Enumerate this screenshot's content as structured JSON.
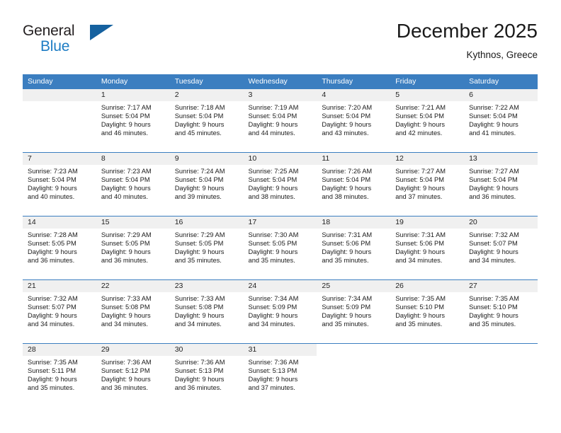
{
  "brand": {
    "name_top": "General",
    "name_bottom": "Blue",
    "logo_icon": "triangle-logo-icon"
  },
  "header": {
    "title": "December 2025",
    "subtitle": "Kythnos, Greece"
  },
  "calendar": {
    "weekday_headers": [
      "Sunday",
      "Monday",
      "Tuesday",
      "Wednesday",
      "Thursday",
      "Friday",
      "Saturday"
    ],
    "colors": {
      "header_blue": "#3b7ec0",
      "brand_blue": "#1d7cc4",
      "logo_blue": "#15619f",
      "daynum_band": "#f0f0f0"
    },
    "weeks": [
      [
        {
          "day": "",
          "detail": ""
        },
        {
          "day": "1",
          "detail": "Sunrise: 7:17 AM\nSunset: 5:04 PM\nDaylight: 9 hours\nand 46 minutes."
        },
        {
          "day": "2",
          "detail": "Sunrise: 7:18 AM\nSunset: 5:04 PM\nDaylight: 9 hours\nand 45 minutes."
        },
        {
          "day": "3",
          "detail": "Sunrise: 7:19 AM\nSunset: 5:04 PM\nDaylight: 9 hours\nand 44 minutes."
        },
        {
          "day": "4",
          "detail": "Sunrise: 7:20 AM\nSunset: 5:04 PM\nDaylight: 9 hours\nand 43 minutes."
        },
        {
          "day": "5",
          "detail": "Sunrise: 7:21 AM\nSunset: 5:04 PM\nDaylight: 9 hours\nand 42 minutes."
        },
        {
          "day": "6",
          "detail": "Sunrise: 7:22 AM\nSunset: 5:04 PM\nDaylight: 9 hours\nand 41 minutes."
        }
      ],
      [
        {
          "day": "7",
          "detail": "Sunrise: 7:23 AM\nSunset: 5:04 PM\nDaylight: 9 hours\nand 40 minutes."
        },
        {
          "day": "8",
          "detail": "Sunrise: 7:23 AM\nSunset: 5:04 PM\nDaylight: 9 hours\nand 40 minutes."
        },
        {
          "day": "9",
          "detail": "Sunrise: 7:24 AM\nSunset: 5:04 PM\nDaylight: 9 hours\nand 39 minutes."
        },
        {
          "day": "10",
          "detail": "Sunrise: 7:25 AM\nSunset: 5:04 PM\nDaylight: 9 hours\nand 38 minutes."
        },
        {
          "day": "11",
          "detail": "Sunrise: 7:26 AM\nSunset: 5:04 PM\nDaylight: 9 hours\nand 38 minutes."
        },
        {
          "day": "12",
          "detail": "Sunrise: 7:27 AM\nSunset: 5:04 PM\nDaylight: 9 hours\nand 37 minutes."
        },
        {
          "day": "13",
          "detail": "Sunrise: 7:27 AM\nSunset: 5:04 PM\nDaylight: 9 hours\nand 36 minutes."
        }
      ],
      [
        {
          "day": "14",
          "detail": "Sunrise: 7:28 AM\nSunset: 5:05 PM\nDaylight: 9 hours\nand 36 minutes."
        },
        {
          "day": "15",
          "detail": "Sunrise: 7:29 AM\nSunset: 5:05 PM\nDaylight: 9 hours\nand 36 minutes."
        },
        {
          "day": "16",
          "detail": "Sunrise: 7:29 AM\nSunset: 5:05 PM\nDaylight: 9 hours\nand 35 minutes."
        },
        {
          "day": "17",
          "detail": "Sunrise: 7:30 AM\nSunset: 5:05 PM\nDaylight: 9 hours\nand 35 minutes."
        },
        {
          "day": "18",
          "detail": "Sunrise: 7:31 AM\nSunset: 5:06 PM\nDaylight: 9 hours\nand 35 minutes."
        },
        {
          "day": "19",
          "detail": "Sunrise: 7:31 AM\nSunset: 5:06 PM\nDaylight: 9 hours\nand 34 minutes."
        },
        {
          "day": "20",
          "detail": "Sunrise: 7:32 AM\nSunset: 5:07 PM\nDaylight: 9 hours\nand 34 minutes."
        }
      ],
      [
        {
          "day": "21",
          "detail": "Sunrise: 7:32 AM\nSunset: 5:07 PM\nDaylight: 9 hours\nand 34 minutes."
        },
        {
          "day": "22",
          "detail": "Sunrise: 7:33 AM\nSunset: 5:08 PM\nDaylight: 9 hours\nand 34 minutes."
        },
        {
          "day": "23",
          "detail": "Sunrise: 7:33 AM\nSunset: 5:08 PM\nDaylight: 9 hours\nand 34 minutes."
        },
        {
          "day": "24",
          "detail": "Sunrise: 7:34 AM\nSunset: 5:09 PM\nDaylight: 9 hours\nand 34 minutes."
        },
        {
          "day": "25",
          "detail": "Sunrise: 7:34 AM\nSunset: 5:09 PM\nDaylight: 9 hours\nand 35 minutes."
        },
        {
          "day": "26",
          "detail": "Sunrise: 7:35 AM\nSunset: 5:10 PM\nDaylight: 9 hours\nand 35 minutes."
        },
        {
          "day": "27",
          "detail": "Sunrise: 7:35 AM\nSunset: 5:10 PM\nDaylight: 9 hours\nand 35 minutes."
        }
      ],
      [
        {
          "day": "28",
          "detail": "Sunrise: 7:35 AM\nSunset: 5:11 PM\nDaylight: 9 hours\nand 35 minutes."
        },
        {
          "day": "29",
          "detail": "Sunrise: 7:36 AM\nSunset: 5:12 PM\nDaylight: 9 hours\nand 36 minutes."
        },
        {
          "day": "30",
          "detail": "Sunrise: 7:36 AM\nSunset: 5:13 PM\nDaylight: 9 hours\nand 36 minutes."
        },
        {
          "day": "31",
          "detail": "Sunrise: 7:36 AM\nSunset: 5:13 PM\nDaylight: 9 hours\nand 37 minutes."
        },
        {
          "day": "",
          "detail": ""
        },
        {
          "day": "",
          "detail": ""
        },
        {
          "day": "",
          "detail": ""
        }
      ]
    ]
  }
}
